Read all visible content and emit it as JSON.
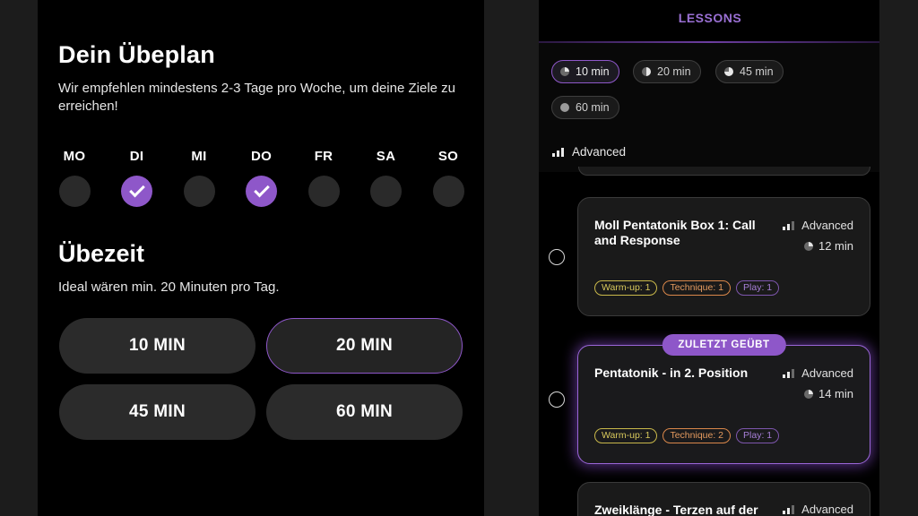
{
  "plan": {
    "title": "Dein Übeplan",
    "description": "Wir empfehlen mindestens 2-3 Tage pro Woche, um deine Ziele zu erreichen!",
    "days": [
      {
        "label": "MO",
        "selected": false
      },
      {
        "label": "DI",
        "selected": true
      },
      {
        "label": "MI",
        "selected": false
      },
      {
        "label": "DO",
        "selected": true
      },
      {
        "label": "FR",
        "selected": false
      },
      {
        "label": "SA",
        "selected": false
      },
      {
        "label": "SO",
        "selected": false
      }
    ]
  },
  "practice_time": {
    "title": "Übezeit",
    "description": "Ideal wären min. 20 Minuten pro Tag.",
    "options": [
      {
        "label": "10 MIN",
        "selected": false
      },
      {
        "label": "20 MIN",
        "selected": true
      },
      {
        "label": "45 MIN",
        "selected": false
      },
      {
        "label": "60 MIN",
        "selected": false
      }
    ]
  },
  "lessons": {
    "title": "LESSONS",
    "filters": [
      {
        "label": "10 min",
        "icon": "pie-quarter-icon",
        "active": true
      },
      {
        "label": "20 min",
        "icon": "pie-half-icon",
        "active": false
      },
      {
        "label": "45 min",
        "icon": "pie-three-quarter-icon",
        "active": false
      },
      {
        "label": "60 min",
        "icon": "pie-full-icon",
        "active": false
      }
    ],
    "level_filter": "Advanced",
    "cards": [
      {
        "title": "Moll Pentatonik Box 1: Call and Response",
        "level": "Advanced",
        "duration": "12 min",
        "tags": [
          "Warm-up: 1",
          "Technique: 1",
          "Play: 1"
        ],
        "highlight": false
      },
      {
        "title": "Pentatonik - in 2. Position",
        "level": "Advanced",
        "duration": "14 min",
        "tags": [
          "Warm-up: 1",
          "Technique: 2",
          "Play: 1"
        ],
        "highlight": true,
        "badge": "ZULETZT GEÜBT"
      },
      {
        "title": "Zweiklänge - Terzen auf der",
        "level": "Advanced",
        "highlight": false
      }
    ]
  },
  "colors": {
    "accent": "#8e57c9",
    "accent_text": "#9a70d4",
    "tag_warmup": "#d8c95c",
    "tag_technique": "#e49a5f",
    "tag_play": "#a77fd8"
  }
}
